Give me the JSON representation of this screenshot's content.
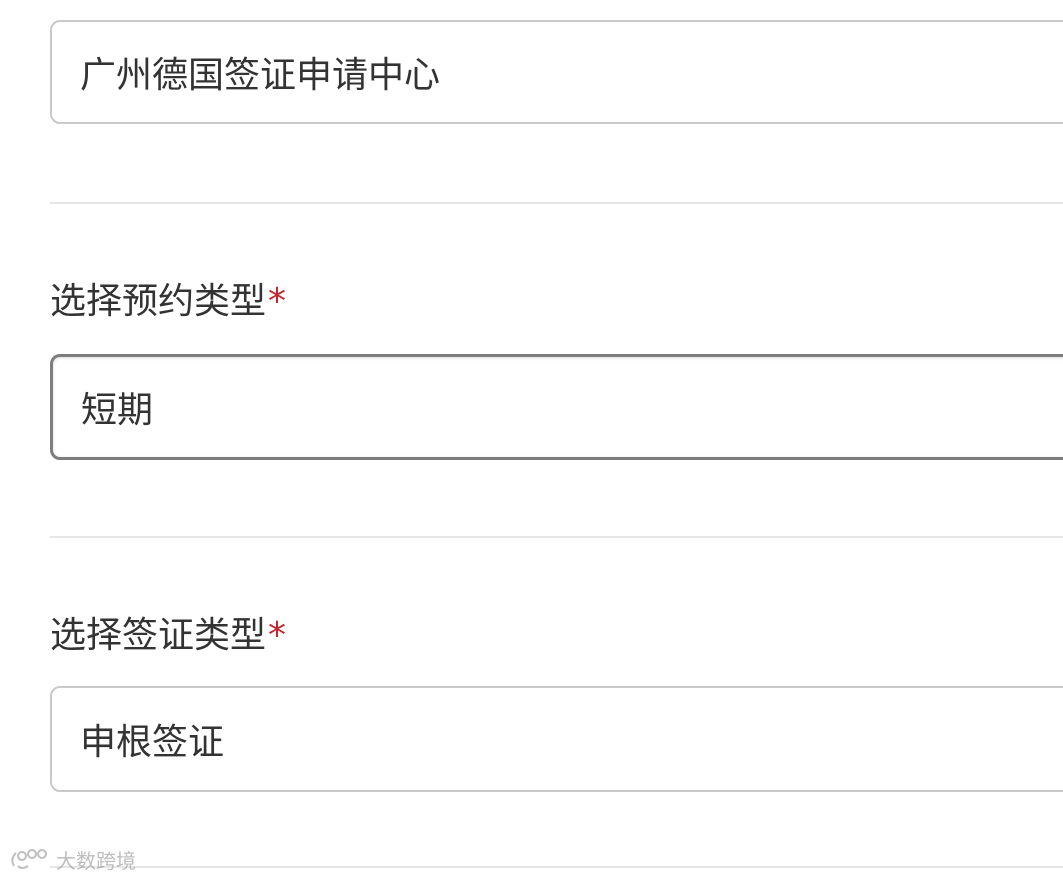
{
  "form": {
    "center": {
      "value": "广州德国签证申请中心"
    },
    "appointment_type": {
      "label": "选择预约类型",
      "required_mark": "*",
      "value": "短期"
    },
    "visa_type": {
      "label": "选择签证类型",
      "required_mark": "*",
      "value": "申根签证"
    }
  },
  "watermark": {
    "text": "大数跨境",
    "icon": "logo-icon"
  },
  "colors": {
    "text": "#333333",
    "required": "#c4262e",
    "border": "#c9c9c9",
    "focused_border": "#7d7d7d",
    "divider": "#e6e6e6"
  }
}
